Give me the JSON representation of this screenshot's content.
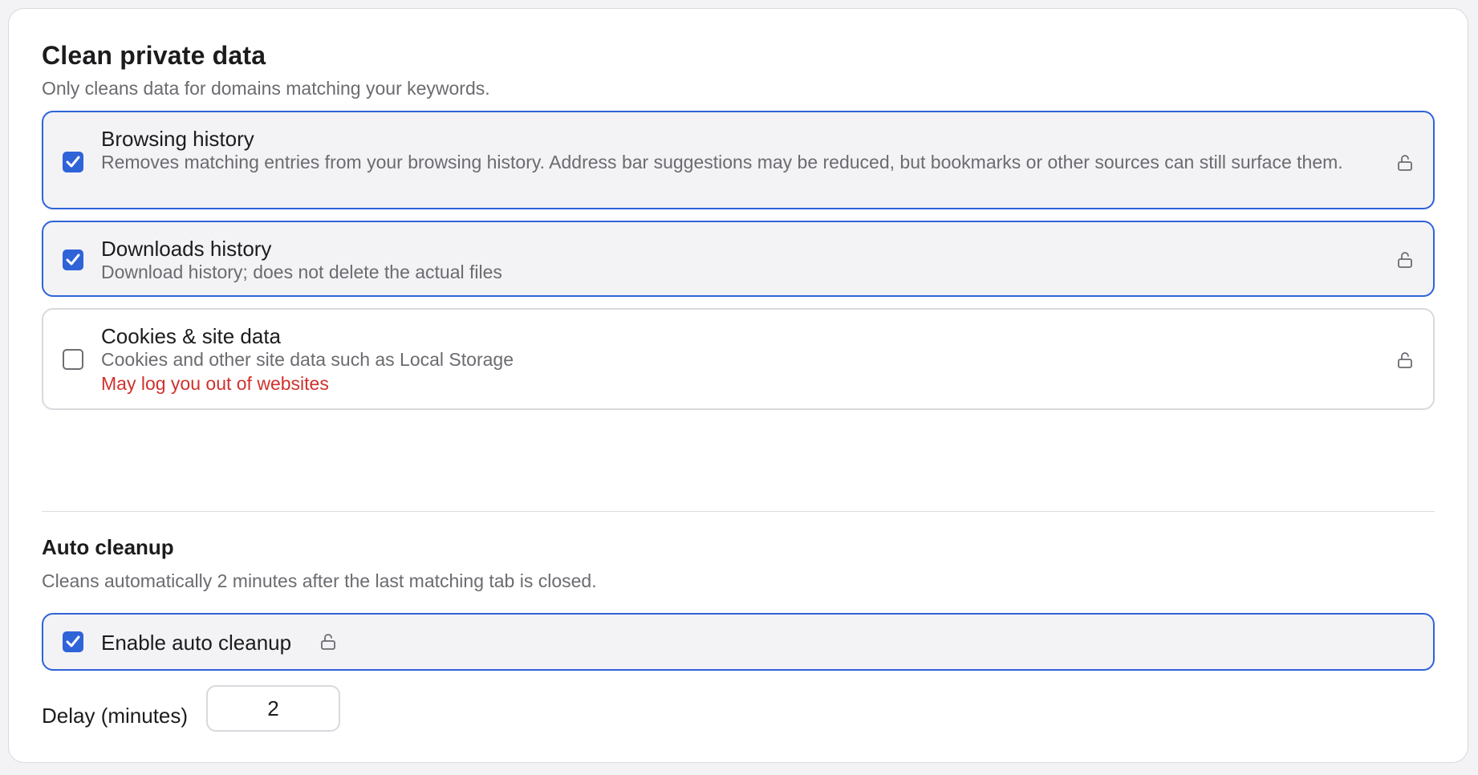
{
  "section": {
    "title": "Clean private data",
    "subtitle": "Only cleans data for domains matching your keywords."
  },
  "options": [
    {
      "title": "Browsing history",
      "description": "Removes matching entries from your browsing history. Address bar suggestions may be reduced, but bookmarks or other sources can still surface them.",
      "checked": true,
      "icon": "lock-open-icon"
    },
    {
      "title": "Downloads history",
      "description": "Download history; does not delete the actual files",
      "checked": true,
      "icon": "lock-open-icon"
    },
    {
      "title": "Cookies & site data",
      "description": "Cookies and other site data such as Local Storage",
      "warning": "May log you out of websites",
      "checked": false,
      "icon": "lock-open-icon"
    }
  ],
  "auto_cleanup": {
    "title": "Auto cleanup",
    "subtitle": "Cleans automatically 2 minutes after the last matching tab is closed.",
    "enable_label": "Enable auto cleanup",
    "enabled": true,
    "delay_label": "Delay (minutes)",
    "delay_value": "2"
  },
  "colors": {
    "accent": "#2f63d8",
    "warning": "#d0312d",
    "muted_text": "#6b6b70",
    "selected_background": "#f3f3f6"
  }
}
